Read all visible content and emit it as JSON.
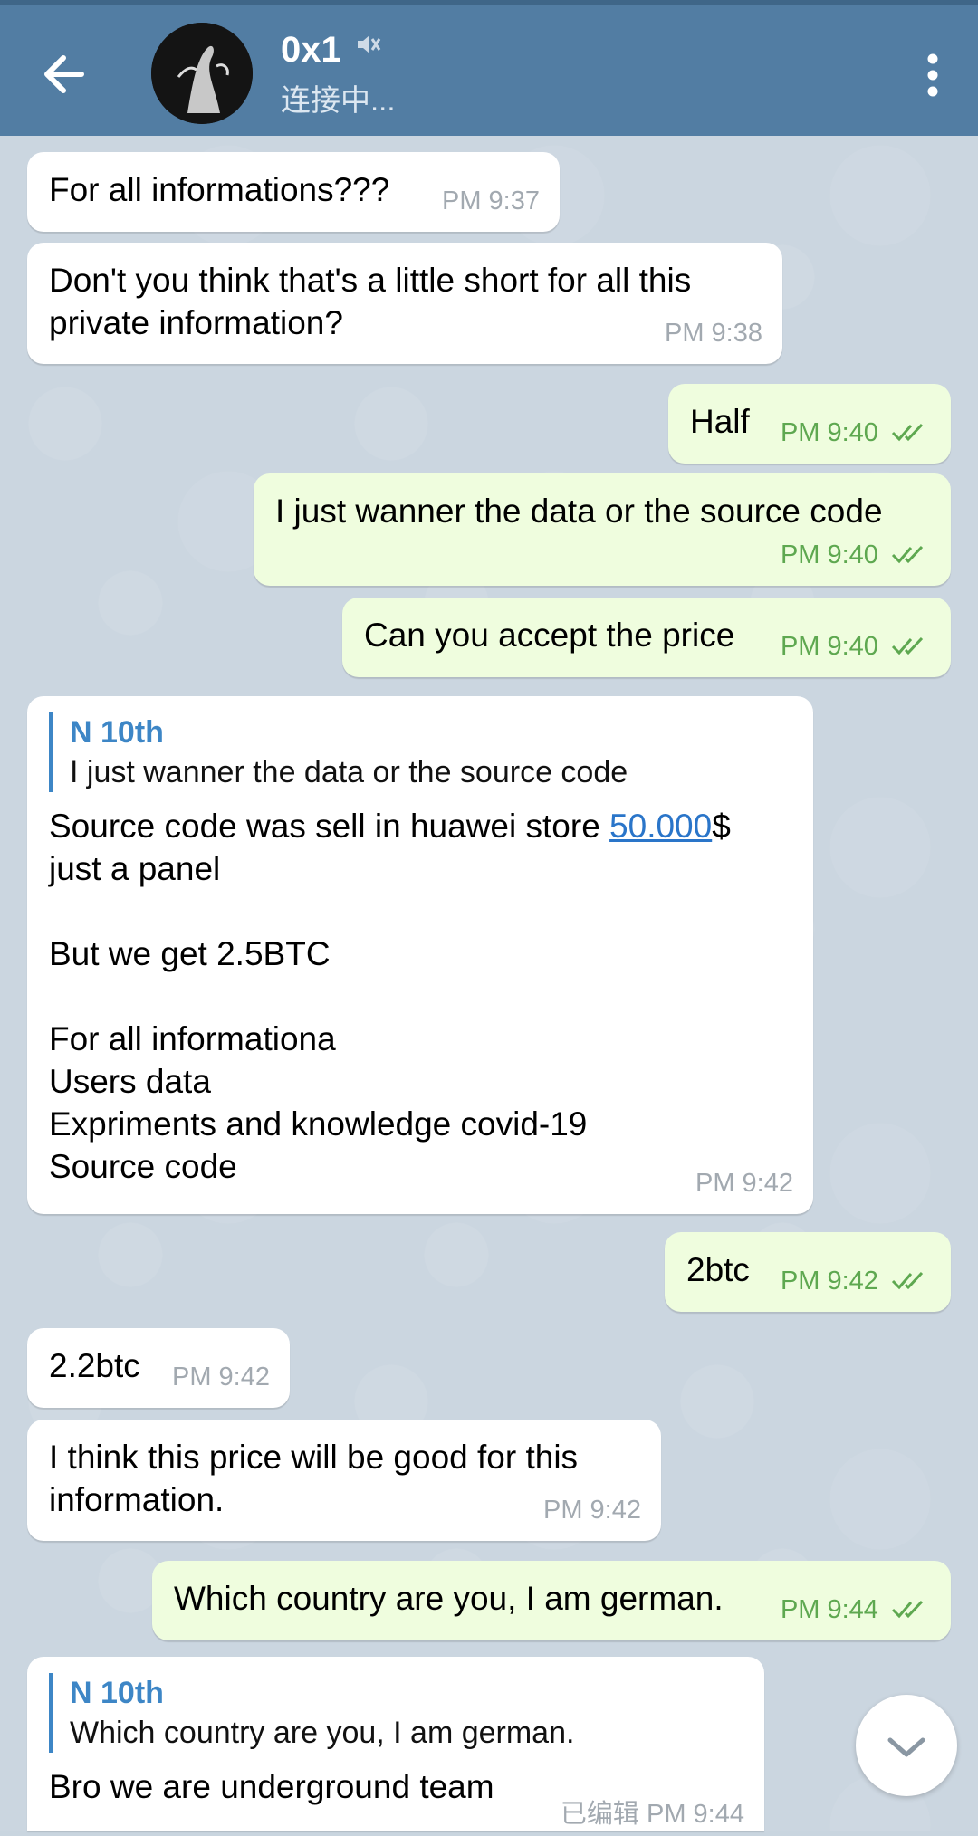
{
  "header": {
    "chat_name": "0x1",
    "status": "连接中..."
  },
  "messages": [
    {
      "direction": "in",
      "text": "For all informations???",
      "time": "PM 9:37"
    },
    {
      "direction": "in",
      "text": "Don't you think that's a little short for all this\nprivate information?",
      "time": "PM 9:38"
    },
    {
      "direction": "out",
      "text": "Half",
      "time": "PM 9:40"
    },
    {
      "direction": "out",
      "text": "I just wanner the data or the source code",
      "time": "PM 9:40"
    },
    {
      "direction": "out",
      "text": "Can you accept the price",
      "time": "PM 9:40"
    },
    {
      "direction": "in",
      "reply_name": "N 10th",
      "reply_text": "I just wanner the data or the source code",
      "text_before_link": "Source code was sell in huawei store ",
      "link": "50.000",
      "text_after_link": "$\njust a panel\n\nBut we get 2.5BTC\n\nFor all informationa\nUsers data\nExpriments and knowledge covid-19\nSource code",
      "time": "PM 9:42"
    },
    {
      "direction": "out",
      "text": "2btc",
      "time": "PM 9:42"
    },
    {
      "direction": "in",
      "text": "2.2btc",
      "time": "PM 9:42"
    },
    {
      "direction": "in",
      "text": "I think this price will be good for this\ninformation.",
      "time": "PM 9:42"
    },
    {
      "direction": "out",
      "text": "Which country are you, I am german.",
      "time": "PM 9:44"
    },
    {
      "direction": "in",
      "reply_name": "N 10th",
      "reply_text": "Which country are you, I am german.",
      "text": "Bro we are underground team",
      "edited": "已编辑",
      "time": "PM 9:44"
    }
  ]
}
